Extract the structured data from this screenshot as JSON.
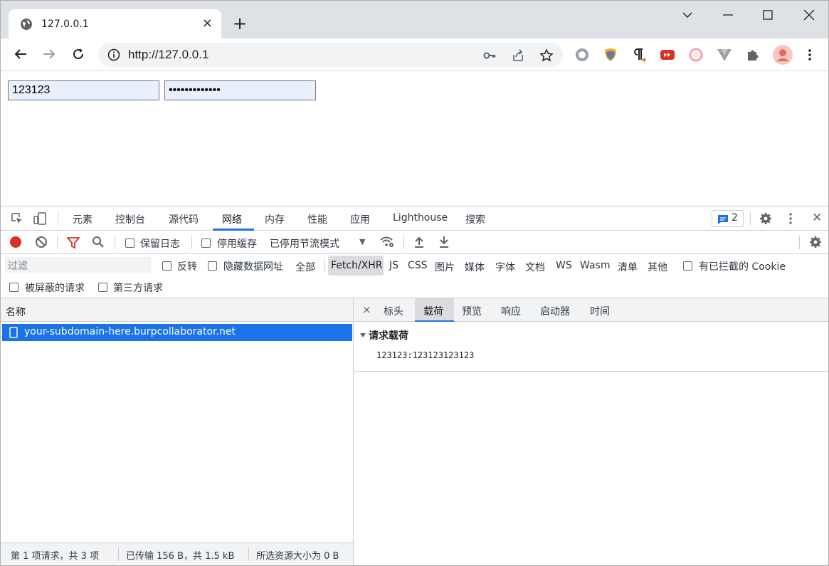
{
  "browser": {
    "tab_title": "127.0.0.1",
    "tab_close": "×",
    "new_tab": "+",
    "url": "http://127.0.0.1"
  },
  "page": {
    "username_value": "123123",
    "password_value": "•••••••••••••"
  },
  "devtools": {
    "tabs": [
      "元素",
      "控制台",
      "源代码",
      "网络",
      "内存",
      "性能",
      "应用",
      "Lighthouse",
      "搜索"
    ],
    "active_tab": "网络",
    "issues_count": "2",
    "close": "✕",
    "toolbar": {
      "preserve_log": "保留日志",
      "disable_cache": "停用缓存",
      "throttling": "已停用节流模式",
      "throttling_arrow": "▼"
    },
    "filter": {
      "placeholder": "过滤",
      "invert": "反转",
      "hide_data_urls": "隐藏数据网址",
      "types": [
        "全部",
        "Fetch/XHR",
        "JS",
        "CSS",
        "图片",
        "媒体",
        "字体",
        "文档",
        "WS",
        "Wasm",
        "清单",
        "其他"
      ],
      "active_type": "Fetch/XHR",
      "blocked_cookies": "有已拦截的 Cookie",
      "blocked_requests": "被屏蔽的请求",
      "third_party": "第三方请求"
    },
    "request_list": {
      "header": "名称",
      "rows": [
        "your-subdomain-here.burpcollaborator.net"
      ]
    },
    "status": {
      "requests": "第 1 项请求，共 3 项",
      "transferred": "已传输 156 B，共 1.5 kB",
      "selected": "所选资源大小为 0 B"
    },
    "details": {
      "close": "×",
      "tabs": [
        "标头",
        "载荷",
        "预览",
        "响应",
        "启动器",
        "时间"
      ],
      "active_tab": "载荷",
      "section_title": "请求载荷",
      "payload": "123123:123123123123"
    }
  },
  "colors": {
    "accent": "#1a73e8",
    "record": "#d93025"
  }
}
